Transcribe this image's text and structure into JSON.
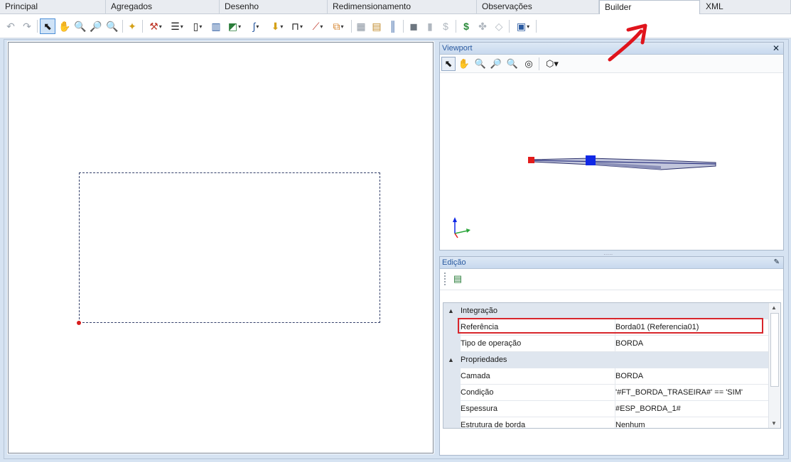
{
  "tabs": [
    "Principal",
    "Agregados",
    "Desenho",
    "Redimensionamento",
    "Observações",
    "Builder",
    "XML"
  ],
  "active_tab": "Builder",
  "toolbar": {
    "undo_icon": "undo-icon",
    "redo_icon": "redo-icon",
    "select_icon": "pointer-icon",
    "pan_icon": "pan-hand-icon",
    "zoom_in_icon": "zoom-in-icon",
    "zoom_out_icon": "zoom-out-icon",
    "zoom_fit_icon": "zoom-extents-icon"
  },
  "viewport": {
    "title": "Viewport",
    "close": "✕"
  },
  "edicao": {
    "title": "Edição",
    "pin": "📌",
    "groups": [
      {
        "label": "Integração",
        "rows": [
          {
            "name": "Referência",
            "value": "Borda01 (Referencia01)"
          },
          {
            "name": "Tipo de operação",
            "value": "BORDA"
          }
        ]
      },
      {
        "label": "Propriedades",
        "rows": [
          {
            "name": "Camada",
            "value": "BORDA"
          },
          {
            "name": "Condição",
            "value": "'#FT_BORDA_TRASEIRA#' == 'SIM'"
          },
          {
            "name": "Espessura",
            "value": "#ESP_BORDA_1#"
          },
          {
            "name": "Estrutura de borda",
            "value": "Nenhum"
          }
        ]
      }
    ]
  },
  "colors": {
    "accent": "#4d8fd6",
    "highlight": "#d8262c",
    "panel": "#d6e3f2"
  }
}
